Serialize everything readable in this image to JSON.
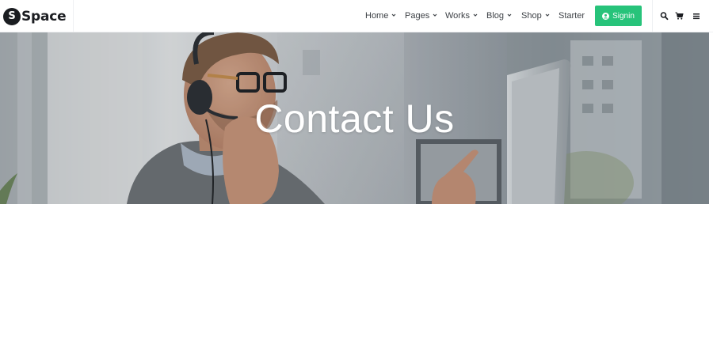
{
  "brand": {
    "mark": "S",
    "name": "Space"
  },
  "nav": {
    "items": [
      {
        "label": "Home",
        "has_dropdown": true
      },
      {
        "label": "Pages",
        "has_dropdown": true
      },
      {
        "label": "Works",
        "has_dropdown": true
      },
      {
        "label": "Blog",
        "has_dropdown": true
      },
      {
        "label": "Shop",
        "has_dropdown": true
      },
      {
        "label": "Starter",
        "has_dropdown": false
      }
    ],
    "signin_label": "Signin"
  },
  "tools": {
    "icons": [
      "search-icon",
      "cart-icon",
      "menu-icon"
    ]
  },
  "hero": {
    "title": "Contact Us"
  },
  "colors": {
    "accent": "#27c37a",
    "text": "#3d4146",
    "brand": "#1b1d21"
  }
}
